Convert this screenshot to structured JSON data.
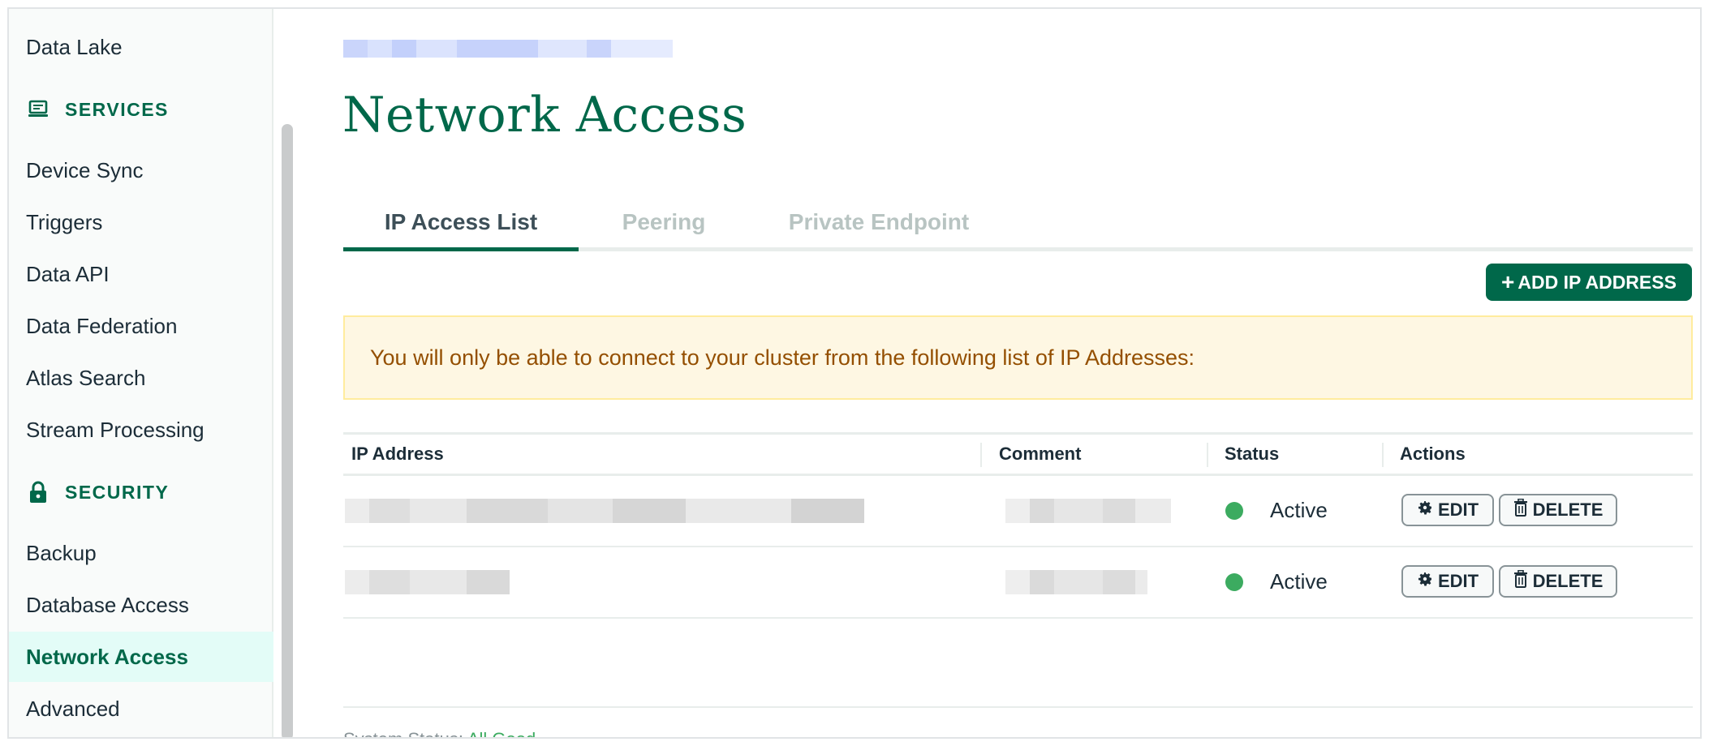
{
  "sidebar": {
    "items_top": [
      {
        "label": "Data Lake"
      }
    ],
    "services_heading": "SERVICES",
    "services": [
      {
        "label": "Device Sync"
      },
      {
        "label": "Triggers"
      },
      {
        "label": "Data API"
      },
      {
        "label": "Data Federation"
      },
      {
        "label": "Atlas Search"
      },
      {
        "label": "Stream Processing"
      }
    ],
    "security_heading": "SECURITY",
    "security": [
      {
        "label": "Backup"
      },
      {
        "label": "Database Access"
      },
      {
        "label": "Network Access"
      },
      {
        "label": "Advanced"
      }
    ]
  },
  "main": {
    "title": "Network Access",
    "tabs": [
      {
        "label": "IP Access List"
      },
      {
        "label": "Peering"
      },
      {
        "label": "Private Endpoint"
      }
    ],
    "add_button_icon": "+",
    "add_button_label": "ADD IP ADDRESS",
    "banner_text": "You will only be able to connect to your cluster from the following list of IP Addresses:",
    "table": {
      "columns": [
        "IP Address",
        "Comment",
        "Status",
        "Actions"
      ],
      "rows": [
        {
          "status": "Active",
          "edit_label": "EDIT",
          "delete_label": "DELETE"
        },
        {
          "status": "Active",
          "edit_label": "EDIT",
          "delete_label": "DELETE"
        }
      ]
    },
    "footer": {
      "label": "System Status:",
      "value": "All Good"
    }
  },
  "colors": {
    "brand": "#00684a",
    "status_active": "#3cab60",
    "banner_bg": "#fef7e3",
    "banner_text": "#944f01"
  }
}
